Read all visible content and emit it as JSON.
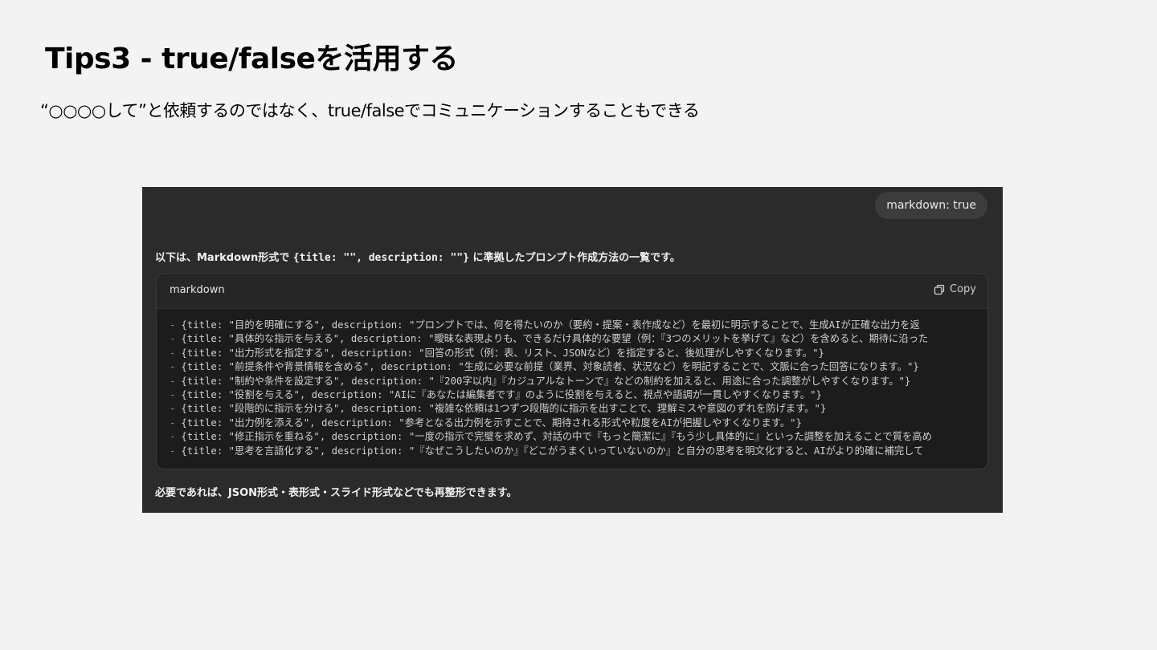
{
  "slide": {
    "title": "Tips3 - true/falseを活用する",
    "subtitle": "“○○○○して”と依頼するのではなく、true/falseでコミュニケーションすることもできる"
  },
  "chat": {
    "user_message": "markdown: true",
    "intro_before": "以下は、Markdown形式で ",
    "intro_code": "{title: \"\", description: \"\"}",
    "intro_after": " に準拠したプロンプト作成方法の一覧です。",
    "code_block": {
      "language": "markdown",
      "copy_label": "Copy",
      "bullet": "-",
      "lines": [
        "{title: \"目的を明確にする\", description: \"プロンプトでは、何を得たいのか（要約・提案・表作成など）を最初に明示することで、生成AIが正確な出力を返",
        "{title: \"具体的な指示を与える\", description: \"曖昧な表現よりも、できるだけ具体的な要望（例：『3つのメリットを挙げて』など）を含めると、期待に沿った",
        "{title: \"出力形式を指定する\", description: \"回答の形式（例：表、リスト、JSONなど）を指定すると、後処理がしやすくなります。\"}",
        "{title: \"前提条件や背景情報を含める\", description: \"生成に必要な前提（業界、対象読者、状況など）を明記することで、文脈に合った回答になります。\"}",
        "{title: \"制約や条件を設定する\", description: \"『200字以内』『カジュアルなトーンで』などの制約を加えると、用途に合った調整がしやすくなります。\"}",
        "{title: \"役割を与える\", description: \"AIに『あなたは編集者です』のように役割を与えると、視点や語調が一貫しやすくなります。\"}",
        "{title: \"段階的に指示を分ける\", description: \"複雑な依頼は1つずつ段階的に指示を出すことで、理解ミスや意図のずれを防げます。\"}",
        "{title: \"出力例を添える\", description: \"参考となる出力例を示すことで、期待される形式や粒度をAIが把握しやすくなります。\"}",
        "{title: \"修正指示を重ねる\", description: \"一度の指示で完璧を求めず、対話の中で『もっと簡潔に』『もう少し具体的に』といった調整を加えることで質を高め",
        "{title: \"思考を言語化する\", description: \"『なぜこうしたいのか』『どこがうまくいっていないのか』と自分の思考を明文化すると、AIがより的確に補完して"
      ]
    },
    "outro": "必要であれば、JSON形式・表形式・スライド形式などでも再整形できます。"
  },
  "colors": {
    "slide_background": "#f3f3f3",
    "chat_background": "#2b2b2b",
    "code_background": "#1c1c1c",
    "bullet": "#5b8fd9"
  },
  "icons": {
    "copy": "copy-icon"
  }
}
